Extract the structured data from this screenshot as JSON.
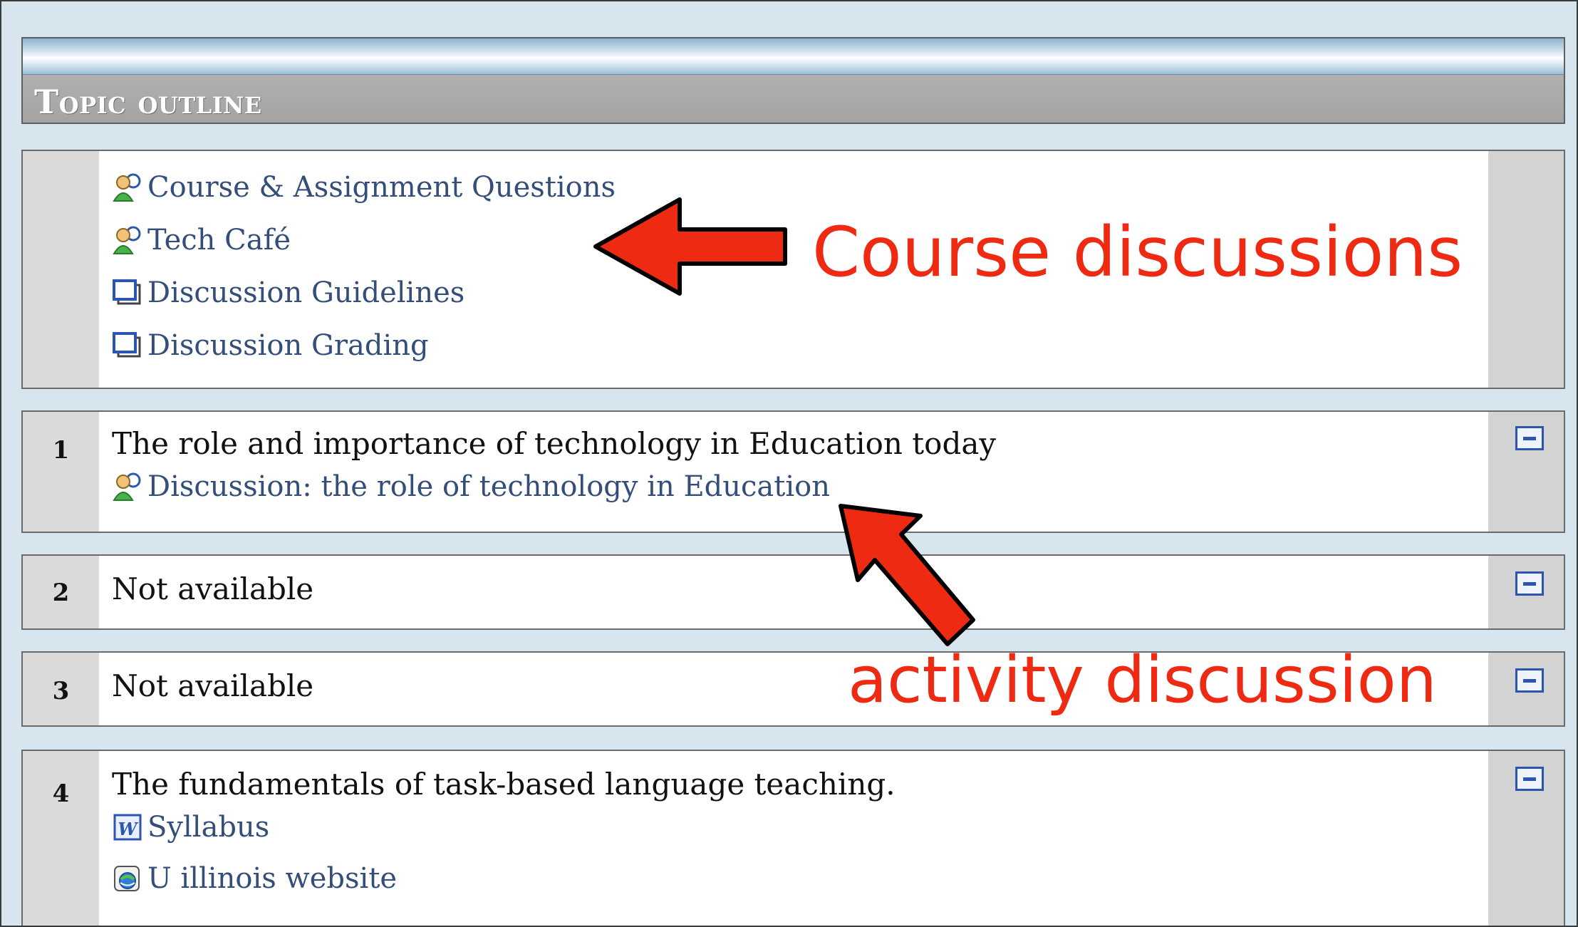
{
  "header": {
    "title": "Topic outline"
  },
  "section0": {
    "items": [
      {
        "label": "Course & Assignment Questions",
        "icon": "forum-icon"
      },
      {
        "label": "Tech Café",
        "icon": "forum-icon"
      },
      {
        "label": "Discussion Guidelines",
        "icon": "page-icon"
      },
      {
        "label": "Discussion Grading",
        "icon": "page-icon"
      }
    ]
  },
  "sections": [
    {
      "number": "1",
      "title": "The role and importance of technology in Education today",
      "items": [
        {
          "label": "Discussion: the role of technology in Education",
          "icon": "forum-icon"
        }
      ]
    },
    {
      "number": "2",
      "title": "Not available"
    },
    {
      "number": "3",
      "title": "Not available"
    },
    {
      "number": "4",
      "title": "The fundamentals of task-based language teaching.",
      "items": [
        {
          "label": "Syllabus",
          "icon": "word-document-icon"
        },
        {
          "label": "U illinois website",
          "icon": "web-link-icon"
        }
      ]
    }
  ],
  "annotations": {
    "course_discussions": "Course discussions",
    "activity_discussion": "activity discussion"
  },
  "colors": {
    "annotation": "#ee2a12",
    "link": "#344e7a",
    "accent": "#2c55b0"
  }
}
